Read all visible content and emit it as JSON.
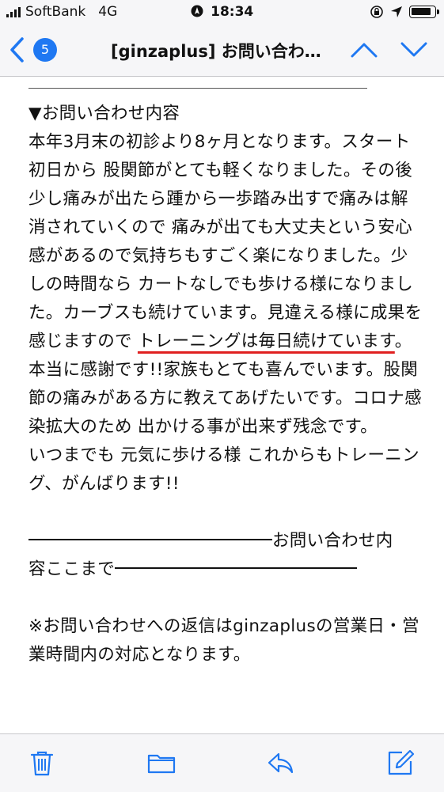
{
  "status_bar": {
    "carrier": "SoftBank",
    "network": "4G",
    "time": "18:34",
    "icons": [
      "signal-icon",
      "location-icon",
      "rotation-lock-icon",
      "location-arrow-icon",
      "battery-icon"
    ]
  },
  "nav": {
    "back_icon": "chevron-left-icon",
    "unread_count": "5",
    "title": "[ginzaplus] お問い合わ…",
    "prev_icon": "chevron-up-icon",
    "next_icon": "chevron-down-icon",
    "accent_color": "#1f78f2"
  },
  "email": {
    "heading": "▼お問い合わせ内容",
    "para1_a": "本年3月末の初診より8ヶ月となります。スタート初日から 股関節がとても軽くなりました。その後 少し痛みが出たら踵から一歩踏み出すで痛みは解消されていくので 痛みが出ても大丈夫という安心感があるので気持ちもすごく楽になりました。少しの時間なら カートなしでも歩ける様になりました。カーブスも続けています。見違える様に成果を感じますので ",
    "para1_highlight": "トレーニングは毎日続けています",
    "para1_b": "。本当に感謝です!!家族もとても喜んでいます。股関節の痛みがある方に教えてあげたいです。コロナ感染拡大のため 出かける事が出来ず残念です。",
    "para2": "いつまでも 元気に歩ける様 これからもトレーニング、がんばります!!",
    "end_marker_1": "お問い合わせ内",
    "end_marker_2": "容ここまで",
    "footer_note": "※お問い合わせへの返信はginzaplusの営業日・営業時間内の対応となります。",
    "highlight_color": "#e02020"
  },
  "toolbar": {
    "icons": [
      "trash-icon",
      "folder-icon",
      "reply-icon",
      "compose-icon"
    ],
    "accent_color": "#1f78f2"
  }
}
